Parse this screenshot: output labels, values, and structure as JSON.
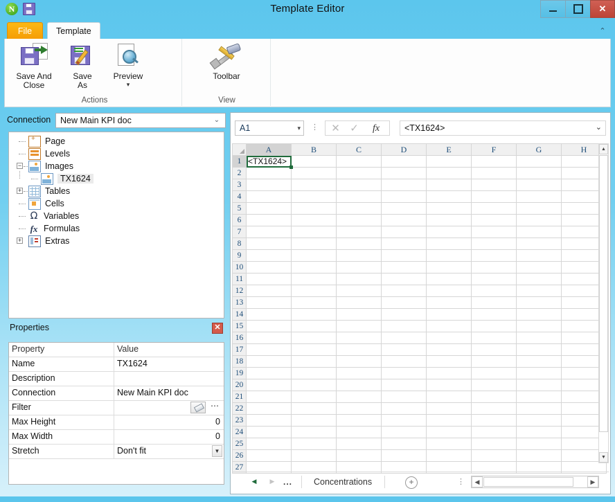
{
  "window": {
    "title": "Template Editor",
    "app_icon": "n-circle-icon",
    "quick_save_icon": "save-disk-icon",
    "minimize": "–",
    "maximize": "□",
    "close": "✕"
  },
  "ribbon": {
    "tabs": [
      {
        "label": "File",
        "id": "file",
        "active": false
      },
      {
        "label": "Template",
        "id": "template",
        "active": true
      }
    ],
    "collapse_icon": "chevron-up-icon",
    "groups": [
      {
        "label": "Actions",
        "buttons": [
          {
            "label_line1": "Save And",
            "label_line2": "Close",
            "icon": "save-and-close-icon",
            "has_caret": false
          },
          {
            "label_line1": "Save",
            "label_line2": "As",
            "icon": "save-as-icon",
            "has_caret": false
          },
          {
            "label_line1": "Preview",
            "label_line2": "",
            "icon": "preview-magnifier-icon",
            "has_caret": true,
            "caret": "▾"
          }
        ]
      },
      {
        "label": "View",
        "buttons": [
          {
            "label_line1": "Toolbar",
            "label_line2": "",
            "icon": "toolbar-wrench-hammer-icon",
            "has_caret": false
          }
        ]
      }
    ]
  },
  "left_panel": {
    "connection": {
      "label": "Connection",
      "value": "New Main KPI doc",
      "dropdown_icon": "chevron-down-icon"
    },
    "tree": [
      {
        "label": "Page",
        "icon": "page-icon",
        "level": 0,
        "expander": "",
        "selected": false
      },
      {
        "label": "Levels",
        "icon": "levels-icon",
        "level": 0,
        "expander": "",
        "selected": false
      },
      {
        "label": "Images",
        "icon": "images-icon",
        "level": 0,
        "expander": "−",
        "selected": false
      },
      {
        "label": "TX1624",
        "icon": "image-item-icon",
        "level": 1,
        "expander": "",
        "selected": true
      },
      {
        "label": "Tables",
        "icon": "tables-icon",
        "level": 0,
        "expander": "+",
        "selected": false
      },
      {
        "label": "Cells",
        "icon": "cells-icon",
        "level": 0,
        "expander": "",
        "selected": false
      },
      {
        "label": "Variables",
        "icon": "omega-icon",
        "level": 0,
        "expander": "",
        "selected": false
      },
      {
        "label": "Formulas",
        "icon": "fx-icon",
        "level": 0,
        "expander": "",
        "selected": false
      },
      {
        "label": "Extras",
        "icon": "extras-icon",
        "level": 0,
        "expander": "+",
        "selected": false
      }
    ],
    "properties": {
      "title": "Properties",
      "close_icon": "close-x-icon",
      "columns": [
        "Property",
        "Value"
      ],
      "rows": [
        {
          "name": "Name",
          "value": "TX1624",
          "type": "text"
        },
        {
          "name": "Description",
          "value": "",
          "type": "text"
        },
        {
          "name": "Connection",
          "value": "New Main KPI doc",
          "type": "text"
        },
        {
          "name": "Filter",
          "value": "",
          "type": "filter",
          "erase_icon": "eraser-icon",
          "more_label": "⋯"
        },
        {
          "name": "Max Height",
          "value": "0",
          "type": "number"
        },
        {
          "name": "Max Width",
          "value": "0",
          "type": "number"
        },
        {
          "name": "Stretch",
          "value": "Don't fit",
          "type": "dropdown",
          "dropdown_icon": "▼"
        }
      ]
    }
  },
  "sheet": {
    "name_box": "A1",
    "name_box_arrow": "▾",
    "grip_icon": "drag-grip-icon",
    "cancel_icon": "✕",
    "confirm_icon": "✓",
    "fx_icon": "fx",
    "formula_value": "<TX1624>",
    "formula_arrow": "❯",
    "columns": [
      "A",
      "B",
      "C",
      "D",
      "E",
      "F",
      "G",
      "H"
    ],
    "active_column": "A",
    "active_row": 1,
    "rows": [
      1,
      2,
      3,
      4,
      5,
      6,
      7,
      8,
      9,
      10,
      11,
      12,
      13,
      14,
      15,
      16,
      17,
      18,
      19,
      20,
      21,
      22,
      23,
      24,
      25,
      26,
      27
    ],
    "cells": {
      "A1": "<TX1624>"
    },
    "vscroll": {
      "up_icon": "▲",
      "down_icon": "▼"
    },
    "tabbar": {
      "first_icon": "◀",
      "last_icon": "▶",
      "more_icon": "...",
      "tabs": [
        "Concentrations"
      ],
      "active_tab": "Concentrations",
      "add_icon": "＋",
      "grip_icon": "drag-grip-icon",
      "hscroll": {
        "left_icon": "◀",
        "right_icon": "▶"
      }
    }
  },
  "colors": {
    "window_accent": "#5bc5ec",
    "file_tab": "#f9a70a",
    "selection_green": "#1f6b3b",
    "close_red": "#c0504d",
    "header_blue": "#1f4e79"
  }
}
